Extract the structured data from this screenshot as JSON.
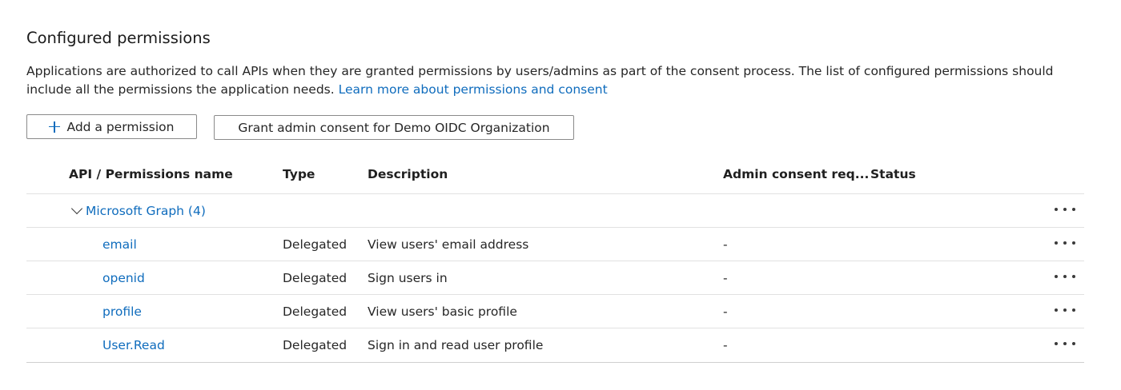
{
  "section": {
    "title": "Configured permissions",
    "description": "Applications are authorized to call APIs when they are granted permissions by users/admins as part of the consent process. The list of configured permissions should include all the permissions the application needs.",
    "learn_more_link": "Learn more about permissions and consent"
  },
  "toolbar": {
    "add_label": "Add a permission",
    "grant_label": "Grant admin consent for Demo OIDC Organization"
  },
  "table": {
    "headers": {
      "name": "API / Permissions name",
      "type": "Type",
      "description": "Description",
      "admin_consent": "Admin consent req...",
      "status": "Status"
    },
    "group": {
      "label": "Microsoft Graph (4)"
    },
    "rows": [
      {
        "name": "email",
        "type": "Delegated",
        "description": "View users' email address",
        "admin_consent": "-",
        "status": ""
      },
      {
        "name": "openid",
        "type": "Delegated",
        "description": "Sign users in",
        "admin_consent": "-",
        "status": ""
      },
      {
        "name": "profile",
        "type": "Delegated",
        "description": "View users' basic profile",
        "admin_consent": "-",
        "status": ""
      },
      {
        "name": "User.Read",
        "type": "Delegated",
        "description": "Sign in and read user profile",
        "admin_consent": "-",
        "status": ""
      }
    ]
  },
  "icons": {
    "add": "plus-icon",
    "expand": "chevron-down-icon",
    "more": "more-actions-icon"
  },
  "colors": {
    "link": "#0f6cbd",
    "text": "#262626",
    "border": "#8a8a8a",
    "divider": "#e1e1e1"
  }
}
